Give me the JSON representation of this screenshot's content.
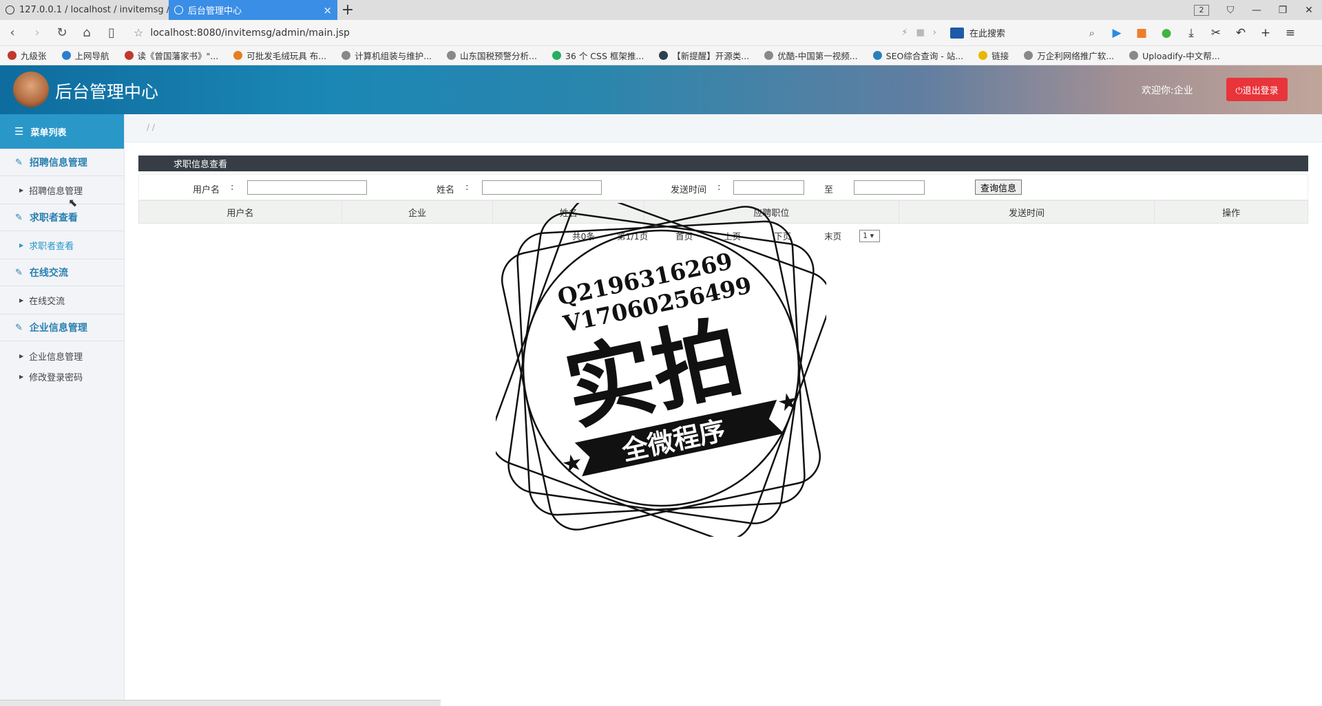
{
  "browser": {
    "tabs": [
      {
        "title": "127.0.0.1 / localhost / invitemsg / ‹"
      },
      {
        "title": "后台管理中心"
      }
    ],
    "tab_count": "2",
    "url": "localhost:8080/invitemsg/admin/main.jsp",
    "search_placeholder": "在此搜索",
    "bookmarks": [
      {
        "label": "九级张",
        "color": "#c0392b"
      },
      {
        "label": "上网导航",
        "color": "#2a7fd0"
      },
      {
        "label": "读《曾国藩家书》\"...",
        "color": "#c0392b"
      },
      {
        "label": "可批发毛绒玩具 布...",
        "color": "#e67e22"
      },
      {
        "label": "计算机组装与维护...",
        "color": "#888888"
      },
      {
        "label": "山东国税预警分析...",
        "color": "#888888"
      },
      {
        "label": "36 个 CSS 框架推...",
        "color": "#27ae60"
      },
      {
        "label": "【新提醒】开源类...",
        "color": "#2c3e50"
      },
      {
        "label": "优酷-中国第一视频...",
        "color": "#888888"
      },
      {
        "label": "SEO综合查询 - 站...",
        "color": "#2980b9"
      },
      {
        "label": "链接",
        "color": "#e6b800"
      },
      {
        "label": "万企利网络推广软...",
        "color": "#888888"
      },
      {
        "label": "Uploadify-中文帮...",
        "color": "#888888"
      }
    ]
  },
  "header": {
    "title": "后台管理中心",
    "welcome": "欢迎你:企业",
    "logout": "⏻退出登录"
  },
  "sidebar": {
    "menu_title": "菜单列表",
    "sections": [
      {
        "label": "招聘信息管理",
        "items": [
          "招聘信息管理"
        ]
      },
      {
        "label": "求职者查看",
        "items": [
          "求职者查看"
        ]
      },
      {
        "label": "在线交流",
        "items": [
          "在线交流"
        ]
      },
      {
        "label": "企业信息管理",
        "items": [
          "企业信息管理",
          "修改登录密码"
        ]
      }
    ]
  },
  "breadcrumb": "/ /",
  "panel": {
    "title": "求职信息查看",
    "filter": {
      "username_label": "用户名",
      "name_label": "姓名",
      "time_label": "发送时间",
      "to_label": "至",
      "colon": ":",
      "query_button": "查询信息"
    },
    "columns": [
      "用户名",
      "企业",
      "姓名",
      "应聘职位",
      "发送时间",
      "操作"
    ],
    "pager": {
      "total": "共0条",
      "page": "第1/1页",
      "first": "首页",
      "prev": "上页",
      "next": "下页",
      "last": "末页",
      "select": "1 ▾"
    }
  },
  "watermark": {
    "line1": "Q2196316269",
    "line2": "V17060256499",
    "big": "实拍",
    "banner": "全微程序"
  }
}
